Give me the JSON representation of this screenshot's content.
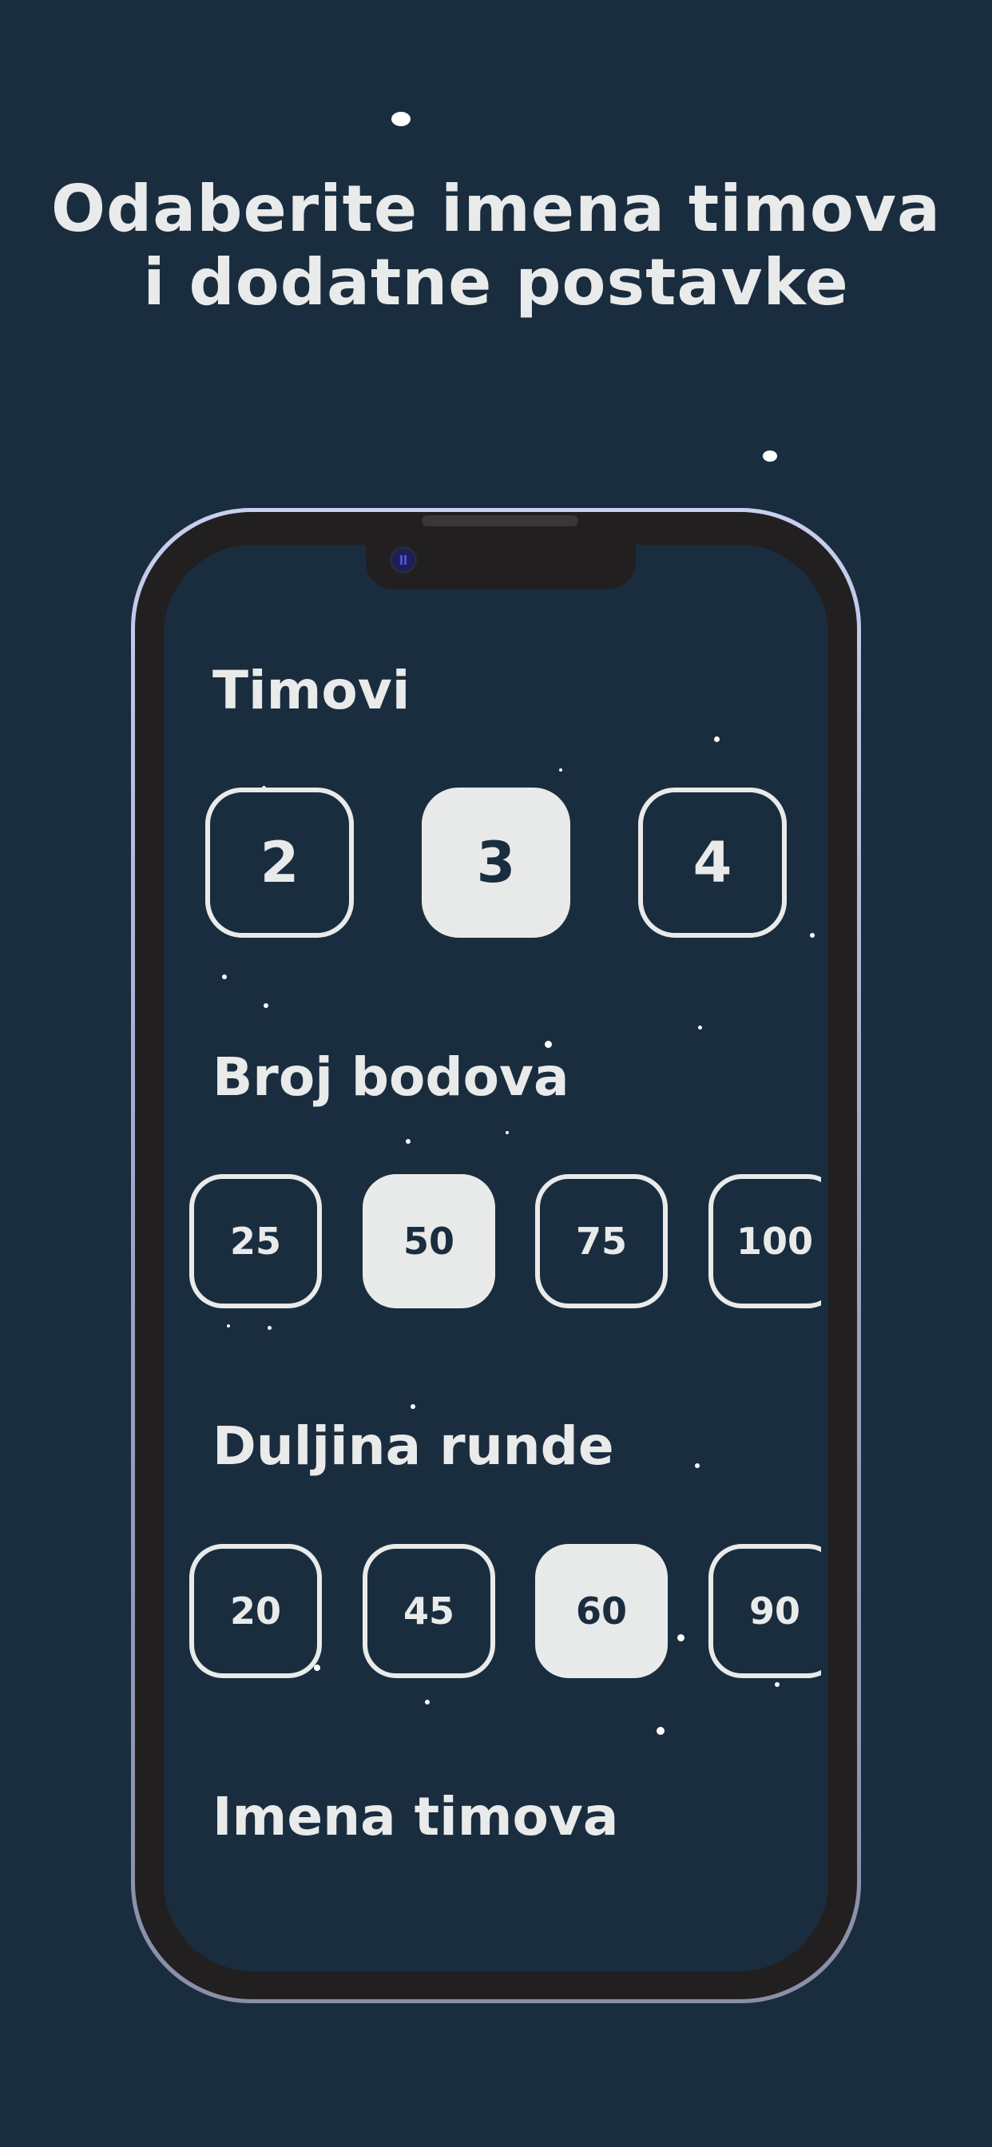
{
  "headline": {
    "line1": "Odaberite imena timova",
    "line2": "i dodatne postavke"
  },
  "phone_screen": {
    "teams": {
      "title": "Timovi",
      "options": [
        "2",
        "3",
        "4"
      ],
      "selected": "3"
    },
    "points": {
      "title": "Broj bodova",
      "options": [
        "25",
        "50",
        "75",
        "100"
      ],
      "selected": "50"
    },
    "round_length": {
      "title": "Duljina runde",
      "options": [
        "20",
        "45",
        "60",
        "90"
      ],
      "selected": "60"
    },
    "team_names": {
      "title": "Imena timova"
    }
  },
  "colors": {
    "background": "#1a2d3f",
    "text": "#e9eaea",
    "selected_fill": "#e8e9e9",
    "phone_bezel": "#221f21"
  }
}
